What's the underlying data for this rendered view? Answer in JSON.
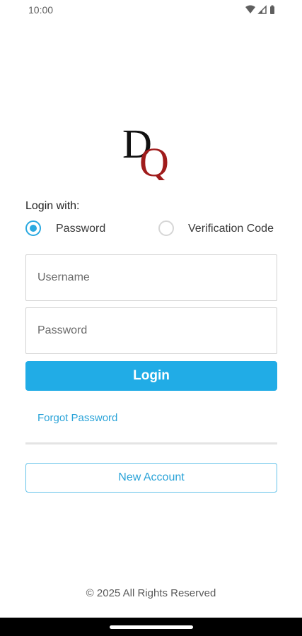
{
  "status_bar": {
    "time": "10:00",
    "icons": [
      "wifi-icon",
      "signal-icon",
      "battery-icon"
    ]
  },
  "logo": {
    "letters": [
      "D",
      "Q"
    ],
    "colors": {
      "d": "#111111",
      "q": "#a01c1c"
    }
  },
  "login": {
    "login_with_label": "Login with:",
    "methods": [
      {
        "label": "Password",
        "selected": true
      },
      {
        "label": "Verification Code",
        "selected": false
      }
    ],
    "username_placeholder": "Username",
    "password_placeholder": "Password",
    "login_button": "Login",
    "forgot_password": "Forgot Password",
    "new_account_button": "New Account"
  },
  "footer": {
    "copyright": "© 2025 All Rights Reserved"
  },
  "colors": {
    "accent": "#21ace6",
    "link": "#2aa3d8"
  }
}
